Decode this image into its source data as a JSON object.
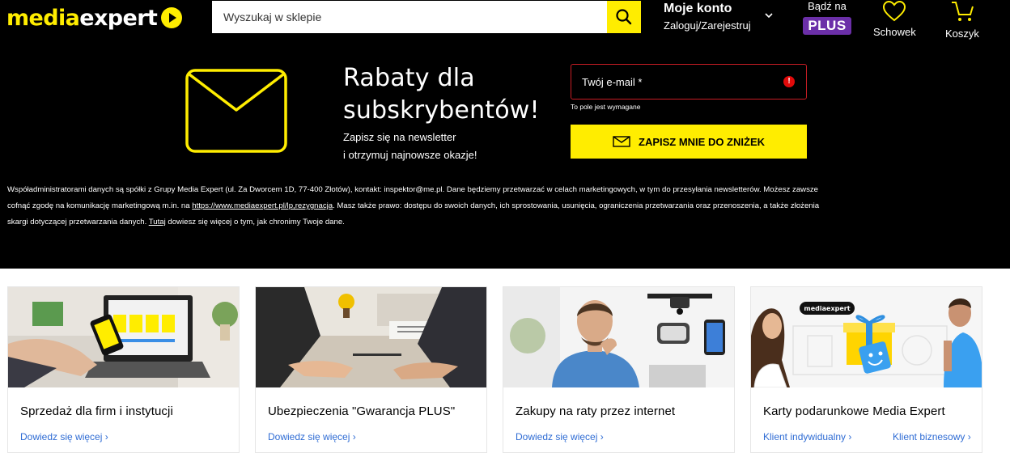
{
  "header": {
    "logo": {
      "part1": "media",
      "part2": "expert"
    },
    "search": {
      "placeholder": "Wyszukaj w sklepie"
    },
    "account": {
      "title": "Moje konto",
      "subtitle": "Zaloguj/Zarejestruj"
    },
    "plus": {
      "label": "Bądź na",
      "badge": "PLUS"
    },
    "wishlist": {
      "label": "Schowek"
    },
    "cart": {
      "label": "Koszyk"
    }
  },
  "newsletter": {
    "title_line1": "Rabaty dla",
    "title_line2": "subskrybentów!",
    "desc_line1": "Zapisz się na newsletter",
    "desc_line2": "i otrzymuj najnowsze okazje!",
    "email_placeholder": "Twój e-mail *",
    "error": "To pole jest wymagane",
    "button": "ZAPISZ MNIE DO ZNIŻEK"
  },
  "legal": {
    "line1": "Współadministratorami danych są spółki z Grupy Media Expert (ul. Za Dworcem 1D, 77-400 Złotów), kontakt: inspektor@me.pl. Dane będziemy przetwarzać w celach marketingowych, w tym do przesyłania newsletterów. Możesz zawsze",
    "line2_before": "cofnąć zgodę na komunikację marketingową m.in. na ",
    "line2_link": "https://www.mediaexpert.pl/lp,rezygnacja",
    "line2_after": ". Masz także prawo: dostępu do swoich danych, ich sprostowania, usunięcia, ograniczenia przetwarzania oraz przenoszenia, a także złożenia",
    "line3_before": "skargi dotyczącej przetwarzania danych. ",
    "line3_link": "Tutaj",
    "line3_after": " dowiesz się więcej o tym, jak chronimy Twoje dane."
  },
  "cards": [
    {
      "title": "Sprzedaż dla firm i instytucji",
      "link": "Dowiedz się więcej ›"
    },
    {
      "title": "Ubezpieczenia \"Gwarancja PLUS\"",
      "link": "Dowiedz się więcej ›"
    },
    {
      "title": "Zakupy na raty przez internet",
      "link": "Dowiedz się więcej ›"
    },
    {
      "title": "Karty podarunkowe Media Expert",
      "link_individual": "Klient indywidualny ›",
      "link_business": "Klient biznesowy ›",
      "image_logo": "mediaexpert"
    }
  ],
  "colors": {
    "brand_yellow": "#ffed00",
    "background": "#000000",
    "link_blue": "#2f6cd4",
    "error_red": "#e10a0a",
    "plus_purple": "#6b2fa8"
  },
  "icons": [
    "search-icon",
    "chevron-down-icon",
    "heart-icon",
    "cart-icon",
    "envelope-icon",
    "error-icon",
    "mail-icon"
  ]
}
